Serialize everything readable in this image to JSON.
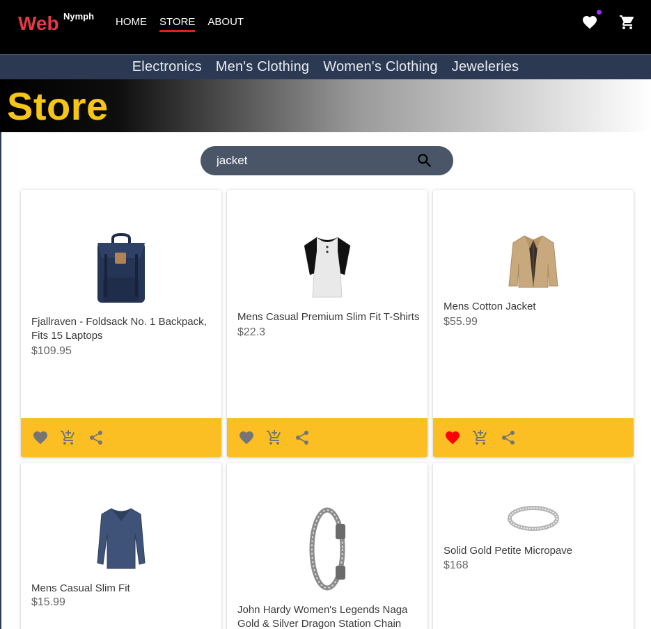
{
  "brand": {
    "main": "Web",
    "super": "Nymph"
  },
  "nav": {
    "home": "HOME",
    "store": "STORE",
    "about": "ABOUT"
  },
  "header_icons": [
    "heart-icon",
    "cart-icon"
  ],
  "categories": [
    "Electronics",
    "Men's Clothing",
    "Women's Clothing",
    "Jeweleries"
  ],
  "banner": {
    "title": "Store"
  },
  "search": {
    "value": "jacket"
  },
  "colors": {
    "brand": "#e63946",
    "accent": "#fbbf24",
    "nav_bg": "#000000",
    "catbar_bg": "#2b3a52",
    "banner_title": "#f5c518",
    "favorite": "#ff0000"
  },
  "products": [
    {
      "title": "Fjallraven - Foldsack No. 1 Backpack, Fits 15 Laptops",
      "price": "$109.95",
      "favorite": false,
      "image": "backpack"
    },
    {
      "title": "Mens Casual Premium Slim Fit T-Shirts",
      "price": "$22.3",
      "favorite": false,
      "image": "raglan-tshirt"
    },
    {
      "title": "Mens Cotton Jacket",
      "price": "$55.99",
      "favorite": true,
      "image": "jacket"
    },
    {
      "title": "Mens Casual Slim Fit",
      "price": "$15.99",
      "favorite": false,
      "image": "long-sleeve-shirt"
    },
    {
      "title": "John Hardy Women's Legends Naga Gold & Silver Dragon Station Chain",
      "price": "",
      "favorite": false,
      "image": "bracelet"
    },
    {
      "title": "Solid Gold Petite Micropave",
      "price": "$168",
      "favorite": false,
      "image": "ring"
    }
  ]
}
